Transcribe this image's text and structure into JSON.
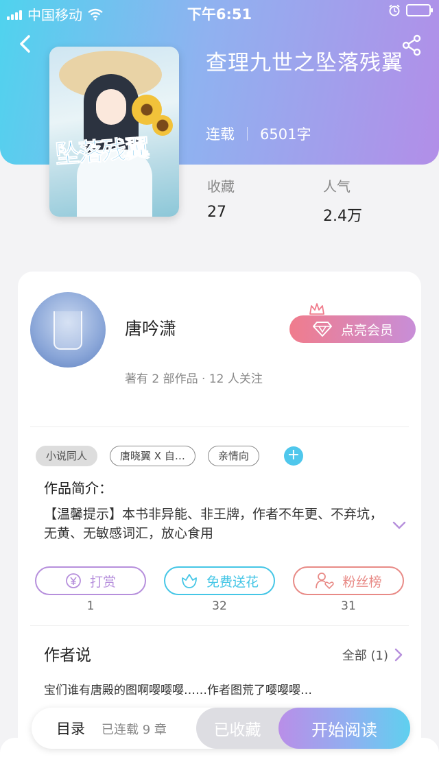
{
  "status_bar": {
    "carrier": "中国移动",
    "time": "下午6:51"
  },
  "book": {
    "title": "查理九世之坠落残翼",
    "status": "连载",
    "word_count": "6501字",
    "cover_title_art": "坠落残翼"
  },
  "stats": {
    "favorites_label": "收藏",
    "favorites_value": "27",
    "popularity_label": "人气",
    "popularity_value": "2.4万"
  },
  "author": {
    "name": "唐吟潇",
    "subtitle": "著有 2 部作品 · 12 人关注",
    "vip_label": "点亮会员"
  },
  "tags": [
    "小说同人",
    "唐晓翼 X 自…",
    "亲情向"
  ],
  "intro": {
    "heading": "作品简介：",
    "text": "【温馨提示】本书非异能、非王牌，作者不年更、不弃坑，无黄、无敏感词汇，放心食用"
  },
  "actions": [
    {
      "label": "打赏",
      "count": "1",
      "color": "#b68fdc"
    },
    {
      "label": "免费送花",
      "count": "32",
      "color": "#45c6e6"
    },
    {
      "label": "粉丝榜",
      "count": "31",
      "color": "#e88a86"
    }
  ],
  "author_says": {
    "heading": "作者说",
    "all_label": "全部 (1)",
    "text": "宝们谁有唐殿的图啊嘤嘤嘤……作者图荒了嘤嘤嘤…"
  },
  "bottom_bar": {
    "toc_label": "目录",
    "chapters_label": "已连载 9 章",
    "favorite_label": "已收藏",
    "read_label": "开始阅读"
  }
}
